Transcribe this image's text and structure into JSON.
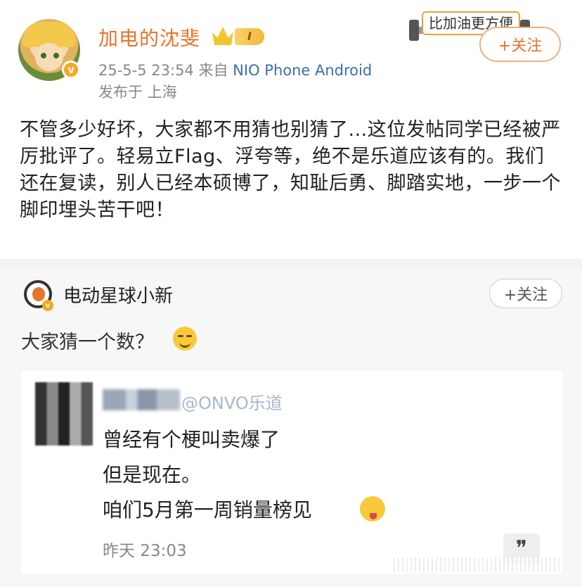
{
  "post": {
    "username": "加电的沈斐",
    "vip_level": "I",
    "verify_badge": "v",
    "date": "25-5-5 23:54",
    "source_prefix": "来自",
    "source": "NIO Phone Android",
    "location": "发布于 上海",
    "sticker_text": "比加油更方便",
    "follow_label": "+关注",
    "text": "不管多少好坏，大家都不用猜也别猜了...这位发帖同学已经被严厉批评了。轻易立Flag、浮夸等，绝不是乐道应该有的。我们还在复读，别人已经本硕博了，知耻后勇、脚踏实地，一步一个脚印埋头苦干吧！"
  },
  "repost": {
    "username": "电动星球小新",
    "follow_label": "+关注",
    "text": "大家猜一个数？",
    "card": {
      "mention": "@ONVO乐道",
      "lines": [
        "曾经有个梗叫卖爆了",
        "但是现在。",
        "咱们5月第一周销量榜见"
      ],
      "time": "昨天 23:03",
      "quote_glyph": "❞"
    }
  },
  "colors": {
    "accent": "#e8742c",
    "link": "#3a6fb0",
    "muted": "#888888",
    "repost_bg": "#f7f7f7"
  }
}
